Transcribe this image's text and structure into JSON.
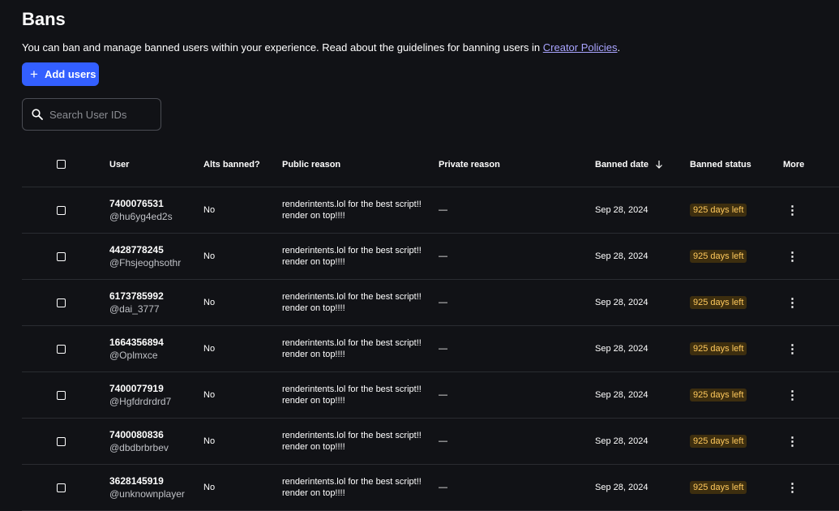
{
  "page": {
    "title": "Bans",
    "description": "You can ban and manage banned users within your experience. Read about the guidelines for banning users in",
    "policies_link": "Creator Policies",
    "description_end": ".",
    "add_button": "Add users",
    "search_placeholder": "Search User IDs"
  },
  "table": {
    "columns": {
      "user": "User",
      "alts": "Alts banned?",
      "public_reason": "Public reason",
      "private_reason": "Private reason",
      "banned_date": "Banned date",
      "banned_status": "Banned status",
      "more": "More"
    },
    "rows": [
      {
        "id": "7400076531",
        "username": "@hu6yg4ed2s",
        "alts": "No",
        "public_reason_1": "renderintents.lol for the best script!!",
        "public_reason_2": "render on top!!!!",
        "private_reason": "—",
        "date": "Sep 28, 2024",
        "status": "925 days left"
      },
      {
        "id": "4428778245",
        "username": "@Fhsjeoghsothr",
        "alts": "No",
        "public_reason_1": "renderintents.lol for the best script!!",
        "public_reason_2": "render on top!!!!",
        "private_reason": "—",
        "date": "Sep 28, 2024",
        "status": "925 days left"
      },
      {
        "id": "6173785992",
        "username": "@dai_3777",
        "alts": "No",
        "public_reason_1": "renderintents.lol for the best script!!",
        "public_reason_2": "render on top!!!!",
        "private_reason": "—",
        "date": "Sep 28, 2024",
        "status": "925 days left"
      },
      {
        "id": "1664356894",
        "username": "@Oplmxce",
        "alts": "No",
        "public_reason_1": "renderintents.lol for the best script!!",
        "public_reason_2": "render on top!!!!",
        "private_reason": "—",
        "date": "Sep 28, 2024",
        "status": "925 days left"
      },
      {
        "id": "7400077919",
        "username": "@Hgfdrdrdrd7",
        "alts": "No",
        "public_reason_1": "renderintents.lol for the best script!!",
        "public_reason_2": "render on top!!!!",
        "private_reason": "—",
        "date": "Sep 28, 2024",
        "status": "925 days left"
      },
      {
        "id": "7400080836",
        "username": "@dbdbrbrbev",
        "alts": "No",
        "public_reason_1": "renderintents.lol for the best script!!",
        "public_reason_2": "render on top!!!!",
        "private_reason": "—",
        "date": "Sep 28, 2024",
        "status": "925 days left"
      },
      {
        "id": "3628145919",
        "username": "@unknownplayer",
        "alts": "No",
        "public_reason_1": "renderintents.lol for the best script!!",
        "public_reason_2": "render on top!!!!",
        "private_reason": "—",
        "date": "Sep 28, 2024",
        "status": "925 days left"
      }
    ]
  },
  "icons": {
    "add": "plus-icon",
    "search": "search-icon",
    "sort": "arrow-down-icon",
    "more": "vertical-dots-icon"
  },
  "colors": {
    "background": "#111216",
    "primary_button": "#335fff",
    "link": "#a9a4ff",
    "badge_bg": "#3d2e0f",
    "badge_text": "#ffc95c"
  }
}
